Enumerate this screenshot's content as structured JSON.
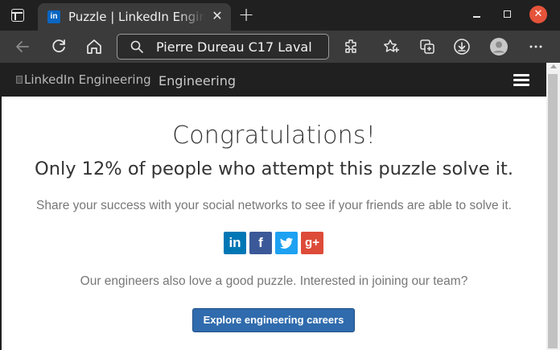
{
  "browser": {
    "tab": {
      "title": "Puzzle | LinkedIn Engineering",
      "favicon": "in",
      "close_glyph": "✕"
    },
    "new_tab_glyph": "+",
    "window_close_glyph": "✕",
    "address": "Pierre Dureau C17 Laval"
  },
  "site": {
    "logo_alt": "LinkedIn Engineering",
    "logo_subtitle": "Engineering"
  },
  "main": {
    "heading": "Congratulations!",
    "stat": "Only 12% of people who attempt this puzzle solve it.",
    "share_text": "Share your success with your social networks to see if your friends are able to solve it.",
    "social": [
      {
        "name": "linkedin",
        "glyph": "in",
        "color": "#0077b5"
      },
      {
        "name": "facebook",
        "glyph": "f",
        "color": "#3b5998"
      },
      {
        "name": "twitter",
        "glyph": "t",
        "color": "#1da1f2"
      },
      {
        "name": "google-plus",
        "glyph": "g+",
        "color": "#dd4b39"
      }
    ],
    "join_text": "Our engineers also love a good puzzle. Interested in joining our team?",
    "cta_label": "Explore engineering careers"
  }
}
